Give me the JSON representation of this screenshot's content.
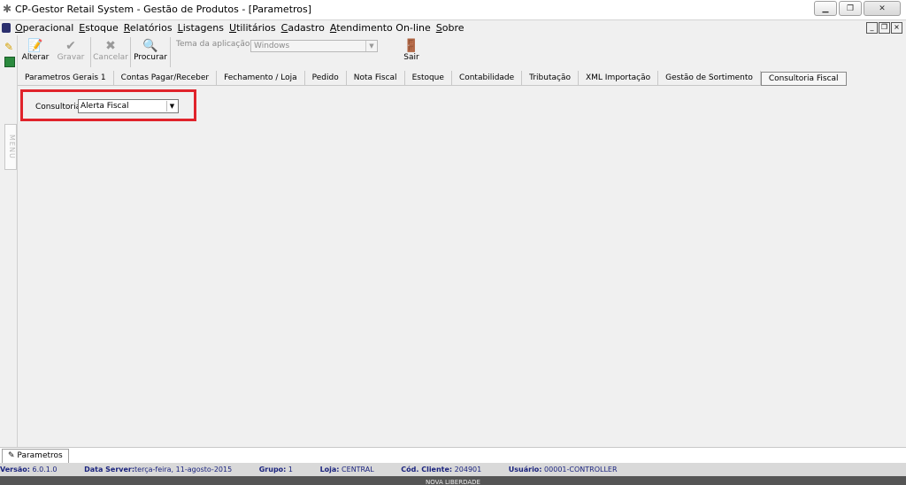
{
  "window": {
    "title": "CP-Gestor Retail System - Gestão de Produtos - [Parametros]"
  },
  "menu": {
    "items": [
      "Operacional",
      "Estoque",
      "Relatórios",
      "Listagens",
      "Utilitários",
      "Cadastro",
      "Atendimento On-line",
      "Sobre"
    ]
  },
  "toolbar": {
    "alterar": "Alterar",
    "gravar": "Gravar",
    "cancelar": "Cancelar",
    "procurar": "Procurar",
    "theme_label": "Tema da aplicação:",
    "theme_value": "Windows",
    "sair": "Sair"
  },
  "tabs": [
    "Parametros Gerais 1",
    "Contas Pagar/Receber",
    "Fechamento / Loja",
    "Pedido",
    "Nota Fiscal",
    "Estoque",
    "Contabilidade",
    "Tributação",
    "XML Importação",
    "Gestão de Sortimento",
    "Consultoria Fiscal"
  ],
  "form": {
    "consultoria_label": "Consultoria",
    "consultoria_value": "Alerta Fiscal"
  },
  "bottom_tab": {
    "label": "Parametros"
  },
  "sidebar": {
    "menu_label": "MENU"
  },
  "status": {
    "versao_label": "Versão:",
    "versao": "6.0.1.0",
    "dataserver_label": "Data Server:",
    "dataserver": "terça-feira, 11-agosto-2015",
    "grupo_label": "Grupo:",
    "grupo": "1",
    "loja_label": "Loja:",
    "loja": "CENTRAL",
    "cliente_label": "Cód. Cliente:",
    "cliente": "204901",
    "usuario_label": "Usuário:",
    "usuario": "00001-CONTROLLER"
  },
  "footer": {
    "brand": "NOVA LIBERDADE"
  },
  "colors": {
    "highlight": "#e0232b",
    "status_text": "#1a237e"
  }
}
